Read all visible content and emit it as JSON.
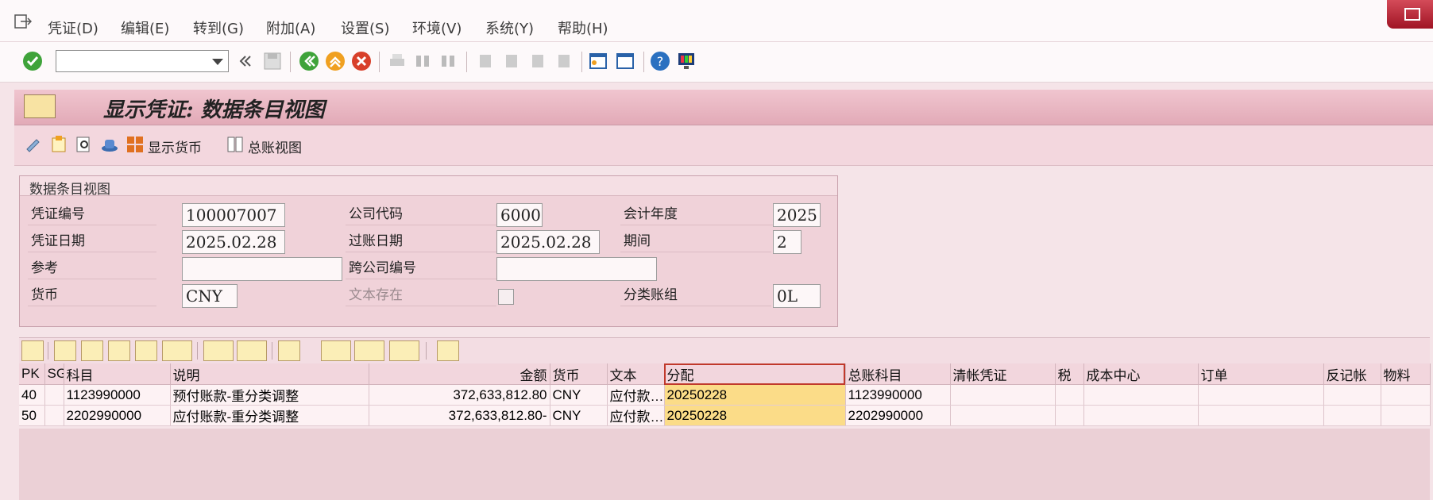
{
  "menu": {
    "items": [
      "凭证(D)",
      "编辑(E)",
      "转到(G)",
      "附加(A)",
      "设置(S)",
      "环境(V)",
      "系统(Y)",
      "帮助(H)"
    ]
  },
  "toolbar": {
    "command_value": ""
  },
  "title": "显示凭证: 数据条目视图",
  "app_toolbar": {
    "show_currency": "显示货币",
    "gl_view": "总账视图"
  },
  "group": {
    "title": "数据条目视图",
    "fields": {
      "doc_no_label": "凭证编号",
      "doc_no": "100007007",
      "company_label": "公司代码",
      "company": "6000",
      "fiscal_year_label": "会计年度",
      "fiscal_year": "2025",
      "doc_date_label": "凭证日期",
      "doc_date": "2025.02.28",
      "posting_date_label": "过账日期",
      "posting_date": "2025.02.28",
      "period_label": "期间",
      "period": "2",
      "reference_label": "参考",
      "reference": "",
      "cross_company_label": "跨公司编号",
      "cross_company": "",
      "currency_label": "货币",
      "currency": "CNY",
      "text_exists_label": "文本存在",
      "ledger_group_label": "分类账组",
      "ledger_group": "0L"
    }
  },
  "table": {
    "columns": [
      "PK",
      "SG",
      "科目",
      "说明",
      "金额",
      "货币",
      "文本",
      "分配",
      "总账科目",
      "清帐凭证",
      "税",
      "成本中心",
      "订单",
      "反记帐",
      "物料"
    ],
    "rows": [
      [
        "40",
        "",
        "1123990000",
        "预付账款-重分类调整",
        "372,633,812.80",
        "CNY",
        "应付款…",
        "20250228",
        "1123990000",
        "",
        "",
        "",
        "",
        "",
        ""
      ],
      [
        "50",
        "",
        "2202990000",
        "应付账款-重分类调整",
        "372,633,812.80-",
        "CNY",
        "应付款…",
        "20250228",
        "2202990000",
        "",
        "",
        "",
        "",
        "",
        ""
      ]
    ]
  },
  "colors": {
    "highlight": "#fbdc88",
    "title_bar": "#e2aab7",
    "background": "#f5e4e8"
  }
}
